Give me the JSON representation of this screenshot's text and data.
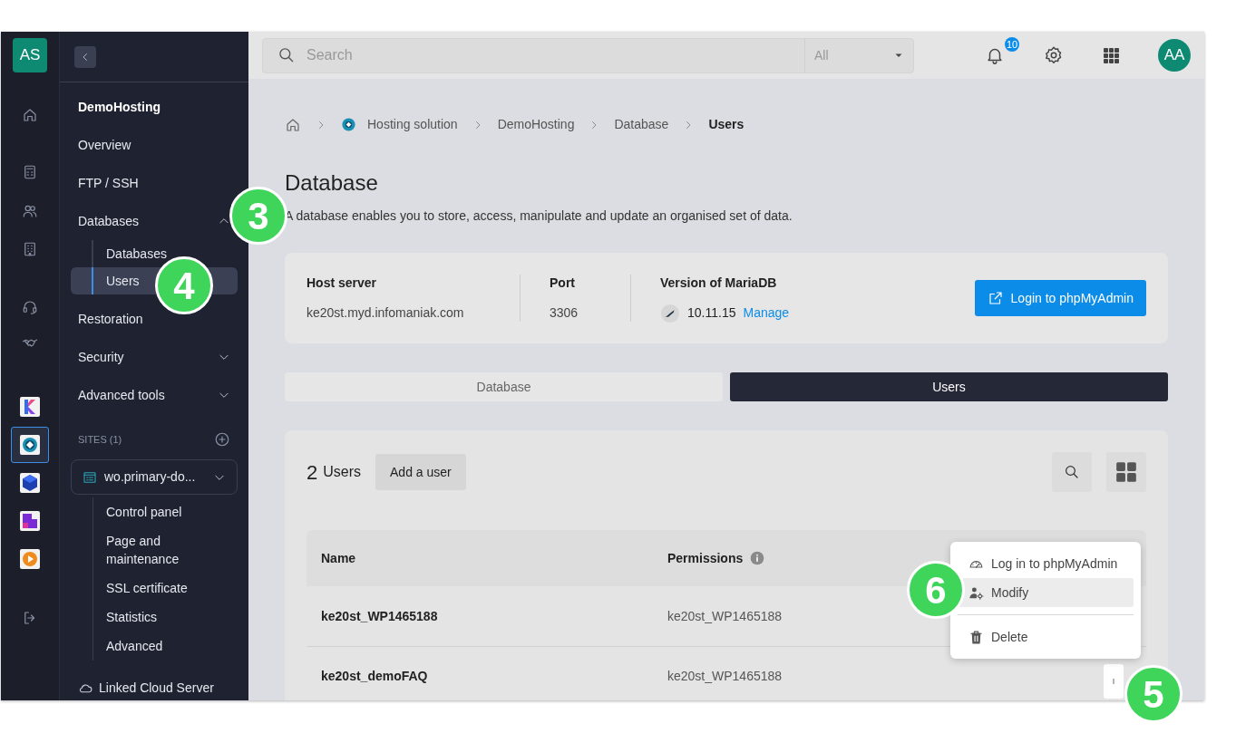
{
  "rail": {
    "avatar": "AS",
    "nav_icons": [
      {
        "kind": "home"
      },
      {
        "kind": "calculator"
      },
      {
        "kind": "users"
      },
      {
        "kind": "building"
      },
      {
        "kind": "headset"
      },
      {
        "kind": "handshake"
      }
    ],
    "apps": [
      {
        "kind": "k",
        "selected": false
      },
      {
        "kind": "hosting",
        "selected": true
      },
      {
        "kind": "cube",
        "selected": false
      },
      {
        "kind": "corner",
        "selected": false
      },
      {
        "kind": "play",
        "selected": false
      }
    ]
  },
  "nav": {
    "title": "DemoHosting",
    "items": [
      {
        "label": "Overview",
        "kind": "link"
      },
      {
        "label": "FTP / SSH",
        "kind": "link"
      },
      {
        "label": "Databases",
        "kind": "group",
        "expanded": true,
        "children": [
          {
            "label": "Databases",
            "selected": false
          },
          {
            "label": "Users",
            "selected": true
          }
        ]
      },
      {
        "label": "Restoration",
        "kind": "link"
      },
      {
        "label": "Security",
        "kind": "group",
        "expanded": false
      },
      {
        "label": "Advanced tools",
        "kind": "group",
        "expanded": false
      }
    ],
    "sites": {
      "heading": "SITES (1)",
      "site": "wo.primary-do...",
      "children": [
        {
          "label": "Control panel"
        },
        {
          "label": "Page and maintenance"
        },
        {
          "label": "SSL certificate"
        },
        {
          "label": "Statistics"
        },
        {
          "label": "Advanced"
        }
      ]
    },
    "footer": "Linked Cloud Server"
  },
  "topbar": {
    "search": {
      "placeholder": "Search"
    },
    "filter": "All",
    "notifications": "10",
    "avatar": "AA"
  },
  "breadcrumbs": [
    {
      "label": "Hosting solution",
      "kind": "product"
    },
    {
      "label": "DemoHosting",
      "kind": "text"
    },
    {
      "label": "Database",
      "kind": "text"
    },
    {
      "label": "Users",
      "kind": "current"
    }
  ],
  "page": {
    "title": "Database",
    "description": "A database enables you to store, access, manipulate and update an organised set of data."
  },
  "info": {
    "host_label": "Host server",
    "host": "ke20st.myd.infomaniak.com",
    "port_label": "Port",
    "port": "3306",
    "version_label": "Version of MariaDB",
    "version": "10.11.15",
    "manage": "Manage",
    "login": "Login to phpMyAdmin"
  },
  "tabs": [
    {
      "label": "Database",
      "selected": false
    },
    {
      "label": "Users",
      "selected": true
    }
  ],
  "users": {
    "count": "2",
    "title": "Users",
    "add": "Add a user",
    "columns": [
      "Name",
      "Permissions"
    ],
    "rows": [
      {
        "name": "ke20st_WP1465188",
        "permissions": "ke20st_WP1465188"
      },
      {
        "name": "ke20st_demoFAQ",
        "permissions": "ke20st_WP1465188"
      }
    ],
    "menu": [
      {
        "label": "Log in to phpMyAdmin",
        "kind": "gauge",
        "selected": false,
        "divider_before": false
      },
      {
        "label": "Modify",
        "kind": "user-gear",
        "selected": true,
        "divider_before": false
      },
      {
        "label": "Delete",
        "kind": "trash",
        "selected": false,
        "divider_before": true
      }
    ]
  },
  "callouts": [
    {
      "label": "3"
    },
    {
      "label": "4"
    },
    {
      "label": "6"
    },
    {
      "label": "5"
    }
  ]
}
